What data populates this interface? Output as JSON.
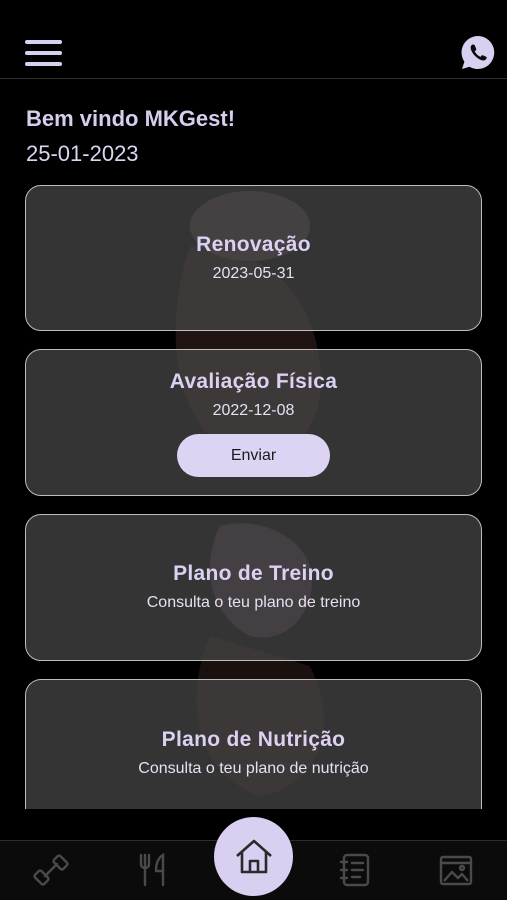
{
  "header": {
    "menu_icon": "hamburger-menu-icon",
    "whatsapp_icon": "whatsapp-icon"
  },
  "greeting": {
    "welcome": "Bem vindo MKGest!",
    "date": "25-01-2023"
  },
  "cards": [
    {
      "title": "Renovação",
      "subtitle": "2023-05-31"
    },
    {
      "title": "Avaliação Física",
      "subtitle": "2022-12-08",
      "button_label": "Enviar"
    },
    {
      "title": "Plano de Treino",
      "subtitle": "Consulta o teu plano de treino"
    },
    {
      "title": "Plano de Nutrição",
      "subtitle": "Consulta o teu plano de nutrição"
    }
  ],
  "bottom_nav": {
    "items": [
      "dumbbell-icon",
      "fork-knife-icon",
      "home-icon",
      "notebook-icon",
      "gallery-icon"
    ],
    "active": "home-icon"
  },
  "colors": {
    "accent": "#d9cff0",
    "background": "#000000",
    "card_border": "#bdbdbd",
    "icon_inactive": "#4a4a4a"
  }
}
